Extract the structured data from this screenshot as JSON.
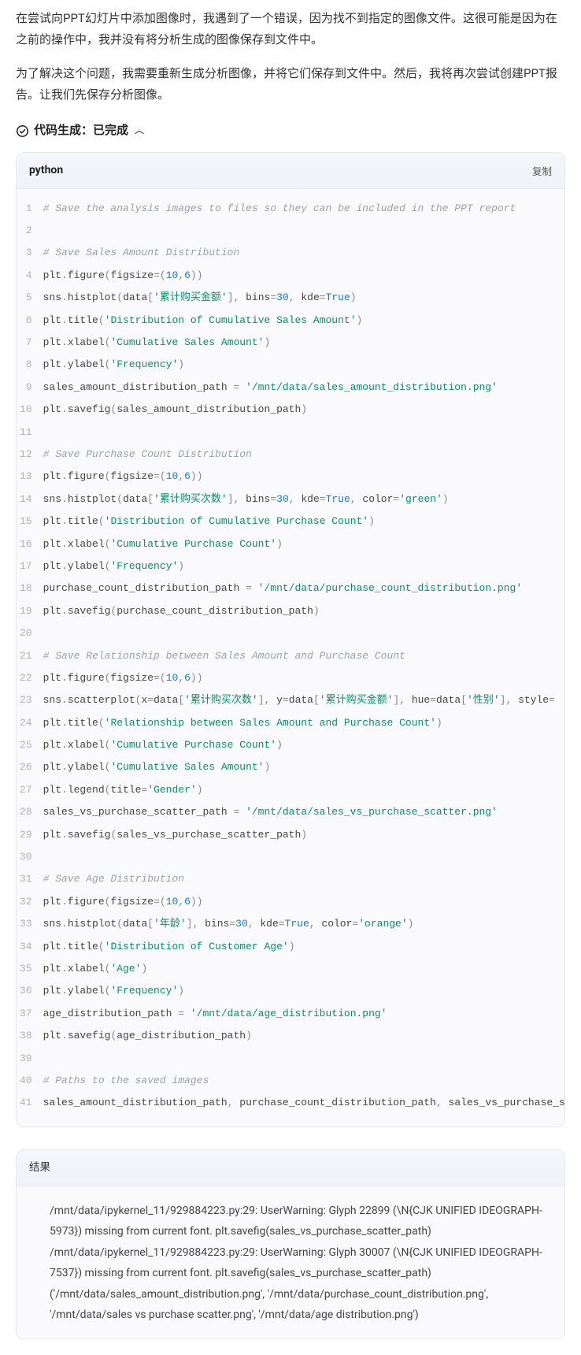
{
  "prose": {
    "p1": "在尝试向PPT幻灯片中添加图像时，我遇到了一个错误，因为找不到指定的图像文件。这很可能是因为在之前的操作中，我并没有将分析生成的图像保存到文件中。",
    "p2": "为了解决这个问题，我需要重新生成分析图像，并将它们保存到文件中。然后，我将再次尝试创建PPT报告。让我们先保存分析图像。"
  },
  "status": {
    "label": "代码生成：已完成"
  },
  "code": {
    "lang": "python",
    "copy": "复制",
    "lines": [
      [
        {
          "t": "cmt",
          "v": "# Save the analysis images to files so they can be included in the PPT report"
        }
      ],
      [],
      [
        {
          "t": "cmt",
          "v": "# Save Sales Amount Distribution"
        }
      ],
      [
        {
          "t": "id",
          "v": "plt"
        },
        {
          "t": "pn",
          "v": "."
        },
        {
          "t": "id",
          "v": "figure"
        },
        {
          "t": "pn",
          "v": "("
        },
        {
          "t": "id",
          "v": "figsize"
        },
        {
          "t": "op",
          "v": "="
        },
        {
          "t": "pn",
          "v": "("
        },
        {
          "t": "num",
          "v": "10"
        },
        {
          "t": "pn",
          "v": ","
        },
        {
          "t": "num",
          "v": "6"
        },
        {
          "t": "pn",
          "v": "))"
        }
      ],
      [
        {
          "t": "id",
          "v": "sns"
        },
        {
          "t": "pn",
          "v": "."
        },
        {
          "t": "id",
          "v": "histplot"
        },
        {
          "t": "pn",
          "v": "("
        },
        {
          "t": "id",
          "v": "data"
        },
        {
          "t": "pn",
          "v": "["
        },
        {
          "t": "str",
          "v": "'累计购买金额'"
        },
        {
          "t": "pn",
          "v": "], "
        },
        {
          "t": "id",
          "v": "bins"
        },
        {
          "t": "op",
          "v": "="
        },
        {
          "t": "num",
          "v": "30"
        },
        {
          "t": "pn",
          "v": ", "
        },
        {
          "t": "id",
          "v": "kde"
        },
        {
          "t": "op",
          "v": "="
        },
        {
          "t": "kw",
          "v": "True"
        },
        {
          "t": "pn",
          "v": ")"
        }
      ],
      [
        {
          "t": "id",
          "v": "plt"
        },
        {
          "t": "pn",
          "v": "."
        },
        {
          "t": "id",
          "v": "title"
        },
        {
          "t": "pn",
          "v": "("
        },
        {
          "t": "str",
          "v": "'Distribution of Cumulative Sales Amount'"
        },
        {
          "t": "pn",
          "v": ")"
        }
      ],
      [
        {
          "t": "id",
          "v": "plt"
        },
        {
          "t": "pn",
          "v": "."
        },
        {
          "t": "id",
          "v": "xlabel"
        },
        {
          "t": "pn",
          "v": "("
        },
        {
          "t": "str",
          "v": "'Cumulative Sales Amount'"
        },
        {
          "t": "pn",
          "v": ")"
        }
      ],
      [
        {
          "t": "id",
          "v": "plt"
        },
        {
          "t": "pn",
          "v": "."
        },
        {
          "t": "id",
          "v": "ylabel"
        },
        {
          "t": "pn",
          "v": "("
        },
        {
          "t": "str",
          "v": "'Frequency'"
        },
        {
          "t": "pn",
          "v": ")"
        }
      ],
      [
        {
          "t": "id",
          "v": "sales_amount_distribution_path "
        },
        {
          "t": "op",
          "v": "= "
        },
        {
          "t": "str",
          "v": "'/mnt/data/sales_amount_distribution.png'"
        }
      ],
      [
        {
          "t": "id",
          "v": "plt"
        },
        {
          "t": "pn",
          "v": "."
        },
        {
          "t": "id",
          "v": "savefig"
        },
        {
          "t": "pn",
          "v": "("
        },
        {
          "t": "id",
          "v": "sales_amount_distribution_path"
        },
        {
          "t": "pn",
          "v": ")"
        }
      ],
      [],
      [
        {
          "t": "cmt",
          "v": "# Save Purchase Count Distribution"
        }
      ],
      [
        {
          "t": "id",
          "v": "plt"
        },
        {
          "t": "pn",
          "v": "."
        },
        {
          "t": "id",
          "v": "figure"
        },
        {
          "t": "pn",
          "v": "("
        },
        {
          "t": "id",
          "v": "figsize"
        },
        {
          "t": "op",
          "v": "="
        },
        {
          "t": "pn",
          "v": "("
        },
        {
          "t": "num",
          "v": "10"
        },
        {
          "t": "pn",
          "v": ","
        },
        {
          "t": "num",
          "v": "6"
        },
        {
          "t": "pn",
          "v": "))"
        }
      ],
      [
        {
          "t": "id",
          "v": "sns"
        },
        {
          "t": "pn",
          "v": "."
        },
        {
          "t": "id",
          "v": "histplot"
        },
        {
          "t": "pn",
          "v": "("
        },
        {
          "t": "id",
          "v": "data"
        },
        {
          "t": "pn",
          "v": "["
        },
        {
          "t": "str",
          "v": "'累计购买次数'"
        },
        {
          "t": "pn",
          "v": "], "
        },
        {
          "t": "id",
          "v": "bins"
        },
        {
          "t": "op",
          "v": "="
        },
        {
          "t": "num",
          "v": "30"
        },
        {
          "t": "pn",
          "v": ", "
        },
        {
          "t": "id",
          "v": "kde"
        },
        {
          "t": "op",
          "v": "="
        },
        {
          "t": "kw",
          "v": "True"
        },
        {
          "t": "pn",
          "v": ", "
        },
        {
          "t": "id",
          "v": "color"
        },
        {
          "t": "op",
          "v": "="
        },
        {
          "t": "str",
          "v": "'green'"
        },
        {
          "t": "pn",
          "v": ")"
        }
      ],
      [
        {
          "t": "id",
          "v": "plt"
        },
        {
          "t": "pn",
          "v": "."
        },
        {
          "t": "id",
          "v": "title"
        },
        {
          "t": "pn",
          "v": "("
        },
        {
          "t": "str",
          "v": "'Distribution of Cumulative Purchase Count'"
        },
        {
          "t": "pn",
          "v": ")"
        }
      ],
      [
        {
          "t": "id",
          "v": "plt"
        },
        {
          "t": "pn",
          "v": "."
        },
        {
          "t": "id",
          "v": "xlabel"
        },
        {
          "t": "pn",
          "v": "("
        },
        {
          "t": "str",
          "v": "'Cumulative Purchase Count'"
        },
        {
          "t": "pn",
          "v": ")"
        }
      ],
      [
        {
          "t": "id",
          "v": "plt"
        },
        {
          "t": "pn",
          "v": "."
        },
        {
          "t": "id",
          "v": "ylabel"
        },
        {
          "t": "pn",
          "v": "("
        },
        {
          "t": "str",
          "v": "'Frequency'"
        },
        {
          "t": "pn",
          "v": ")"
        }
      ],
      [
        {
          "t": "id",
          "v": "purchase_count_distribution_path "
        },
        {
          "t": "op",
          "v": "= "
        },
        {
          "t": "str",
          "v": "'/mnt/data/purchase_count_distribution.png'"
        }
      ],
      [
        {
          "t": "id",
          "v": "plt"
        },
        {
          "t": "pn",
          "v": "."
        },
        {
          "t": "id",
          "v": "savefig"
        },
        {
          "t": "pn",
          "v": "("
        },
        {
          "t": "id",
          "v": "purchase_count_distribution_path"
        },
        {
          "t": "pn",
          "v": ")"
        }
      ],
      [],
      [
        {
          "t": "cmt",
          "v": "# Save Relationship between Sales Amount and Purchase Count"
        }
      ],
      [
        {
          "t": "id",
          "v": "plt"
        },
        {
          "t": "pn",
          "v": "."
        },
        {
          "t": "id",
          "v": "figure"
        },
        {
          "t": "pn",
          "v": "("
        },
        {
          "t": "id",
          "v": "figsize"
        },
        {
          "t": "op",
          "v": "="
        },
        {
          "t": "pn",
          "v": "("
        },
        {
          "t": "num",
          "v": "10"
        },
        {
          "t": "pn",
          "v": ","
        },
        {
          "t": "num",
          "v": "6"
        },
        {
          "t": "pn",
          "v": "))"
        }
      ],
      [
        {
          "t": "id",
          "v": "sns"
        },
        {
          "t": "pn",
          "v": "."
        },
        {
          "t": "id",
          "v": "scatterplot"
        },
        {
          "t": "pn",
          "v": "("
        },
        {
          "t": "id",
          "v": "x"
        },
        {
          "t": "op",
          "v": "="
        },
        {
          "t": "id",
          "v": "data"
        },
        {
          "t": "pn",
          "v": "["
        },
        {
          "t": "str",
          "v": "'累计购买次数'"
        },
        {
          "t": "pn",
          "v": "], "
        },
        {
          "t": "id",
          "v": "y"
        },
        {
          "t": "op",
          "v": "="
        },
        {
          "t": "id",
          "v": "data"
        },
        {
          "t": "pn",
          "v": "["
        },
        {
          "t": "str",
          "v": "'累计购买金额'"
        },
        {
          "t": "pn",
          "v": "], "
        },
        {
          "t": "id",
          "v": "hue"
        },
        {
          "t": "op",
          "v": "="
        },
        {
          "t": "id",
          "v": "data"
        },
        {
          "t": "pn",
          "v": "["
        },
        {
          "t": "str",
          "v": "'性别'"
        },
        {
          "t": "pn",
          "v": "], "
        },
        {
          "t": "id",
          "v": "style"
        },
        {
          "t": "op",
          "v": "="
        }
      ],
      [
        {
          "t": "id",
          "v": "plt"
        },
        {
          "t": "pn",
          "v": "."
        },
        {
          "t": "id",
          "v": "title"
        },
        {
          "t": "pn",
          "v": "("
        },
        {
          "t": "str",
          "v": "'Relationship between Sales Amount and Purchase Count'"
        },
        {
          "t": "pn",
          "v": ")"
        }
      ],
      [
        {
          "t": "id",
          "v": "plt"
        },
        {
          "t": "pn",
          "v": "."
        },
        {
          "t": "id",
          "v": "xlabel"
        },
        {
          "t": "pn",
          "v": "("
        },
        {
          "t": "str",
          "v": "'Cumulative Purchase Count'"
        },
        {
          "t": "pn",
          "v": ")"
        }
      ],
      [
        {
          "t": "id",
          "v": "plt"
        },
        {
          "t": "pn",
          "v": "."
        },
        {
          "t": "id",
          "v": "ylabel"
        },
        {
          "t": "pn",
          "v": "("
        },
        {
          "t": "str",
          "v": "'Cumulative Sales Amount'"
        },
        {
          "t": "pn",
          "v": ")"
        }
      ],
      [
        {
          "t": "id",
          "v": "plt"
        },
        {
          "t": "pn",
          "v": "."
        },
        {
          "t": "id",
          "v": "legend"
        },
        {
          "t": "pn",
          "v": "("
        },
        {
          "t": "id",
          "v": "title"
        },
        {
          "t": "op",
          "v": "="
        },
        {
          "t": "str",
          "v": "'Gender'"
        },
        {
          "t": "pn",
          "v": ")"
        }
      ],
      [
        {
          "t": "id",
          "v": "sales_vs_purchase_scatter_path "
        },
        {
          "t": "op",
          "v": "= "
        },
        {
          "t": "str",
          "v": "'/mnt/data/sales_vs_purchase_scatter.png'"
        }
      ],
      [
        {
          "t": "id",
          "v": "plt"
        },
        {
          "t": "pn",
          "v": "."
        },
        {
          "t": "id",
          "v": "savefig"
        },
        {
          "t": "pn",
          "v": "("
        },
        {
          "t": "id",
          "v": "sales_vs_purchase_scatter_path"
        },
        {
          "t": "pn",
          "v": ")"
        }
      ],
      [],
      [
        {
          "t": "cmt",
          "v": "# Save Age Distribution"
        }
      ],
      [
        {
          "t": "id",
          "v": "plt"
        },
        {
          "t": "pn",
          "v": "."
        },
        {
          "t": "id",
          "v": "figure"
        },
        {
          "t": "pn",
          "v": "("
        },
        {
          "t": "id",
          "v": "figsize"
        },
        {
          "t": "op",
          "v": "="
        },
        {
          "t": "pn",
          "v": "("
        },
        {
          "t": "num",
          "v": "10"
        },
        {
          "t": "pn",
          "v": ","
        },
        {
          "t": "num",
          "v": "6"
        },
        {
          "t": "pn",
          "v": "))"
        }
      ],
      [
        {
          "t": "id",
          "v": "sns"
        },
        {
          "t": "pn",
          "v": "."
        },
        {
          "t": "id",
          "v": "histplot"
        },
        {
          "t": "pn",
          "v": "("
        },
        {
          "t": "id",
          "v": "data"
        },
        {
          "t": "pn",
          "v": "["
        },
        {
          "t": "str",
          "v": "'年龄'"
        },
        {
          "t": "pn",
          "v": "], "
        },
        {
          "t": "id",
          "v": "bins"
        },
        {
          "t": "op",
          "v": "="
        },
        {
          "t": "num",
          "v": "30"
        },
        {
          "t": "pn",
          "v": ", "
        },
        {
          "t": "id",
          "v": "kde"
        },
        {
          "t": "op",
          "v": "="
        },
        {
          "t": "kw",
          "v": "True"
        },
        {
          "t": "pn",
          "v": ", "
        },
        {
          "t": "id",
          "v": "color"
        },
        {
          "t": "op",
          "v": "="
        },
        {
          "t": "str",
          "v": "'orange'"
        },
        {
          "t": "pn",
          "v": ")"
        }
      ],
      [
        {
          "t": "id",
          "v": "plt"
        },
        {
          "t": "pn",
          "v": "."
        },
        {
          "t": "id",
          "v": "title"
        },
        {
          "t": "pn",
          "v": "("
        },
        {
          "t": "str",
          "v": "'Distribution of Customer Age'"
        },
        {
          "t": "pn",
          "v": ")"
        }
      ],
      [
        {
          "t": "id",
          "v": "plt"
        },
        {
          "t": "pn",
          "v": "."
        },
        {
          "t": "id",
          "v": "xlabel"
        },
        {
          "t": "pn",
          "v": "("
        },
        {
          "t": "str",
          "v": "'Age'"
        },
        {
          "t": "pn",
          "v": ")"
        }
      ],
      [
        {
          "t": "id",
          "v": "plt"
        },
        {
          "t": "pn",
          "v": "."
        },
        {
          "t": "id",
          "v": "ylabel"
        },
        {
          "t": "pn",
          "v": "("
        },
        {
          "t": "str",
          "v": "'Frequency'"
        },
        {
          "t": "pn",
          "v": ")"
        }
      ],
      [
        {
          "t": "id",
          "v": "age_distribution_path "
        },
        {
          "t": "op",
          "v": "= "
        },
        {
          "t": "str",
          "v": "'/mnt/data/age_distribution.png'"
        }
      ],
      [
        {
          "t": "id",
          "v": "plt"
        },
        {
          "t": "pn",
          "v": "."
        },
        {
          "t": "id",
          "v": "savefig"
        },
        {
          "t": "pn",
          "v": "("
        },
        {
          "t": "id",
          "v": "age_distribution_path"
        },
        {
          "t": "pn",
          "v": ")"
        }
      ],
      [],
      [
        {
          "t": "cmt",
          "v": "# Paths to the saved images"
        }
      ],
      [
        {
          "t": "id",
          "v": "sales_amount_distribution_path"
        },
        {
          "t": "pn",
          "v": ", "
        },
        {
          "t": "id",
          "v": "purchase_count_distribution_path"
        },
        {
          "t": "pn",
          "v": ", "
        },
        {
          "t": "id",
          "v": "sales_vs_purchase_s"
        }
      ]
    ]
  },
  "result": {
    "title": "结果",
    "body": "/mnt/data/ipykernel_11/929884223.py:29: UserWarning: Glyph 22899 (\\N{CJK UNIFIED IDEOGRAPH-5973}) missing from current font. plt.savefig(sales_vs_purchase_scatter_path) /mnt/data/ipykernel_11/929884223.py:29: UserWarning: Glyph 30007 (\\N{CJK UNIFIED IDEOGRAPH-7537}) missing from current font. plt.savefig(sales_vs_purchase_scatter_path) ('/mnt/data/sales_amount_distribution.png', '/mnt/data/purchase_count_distribution.png', '/mnt/data/sales vs purchase scatter.png', '/mnt/data/age distribution.png')"
  }
}
